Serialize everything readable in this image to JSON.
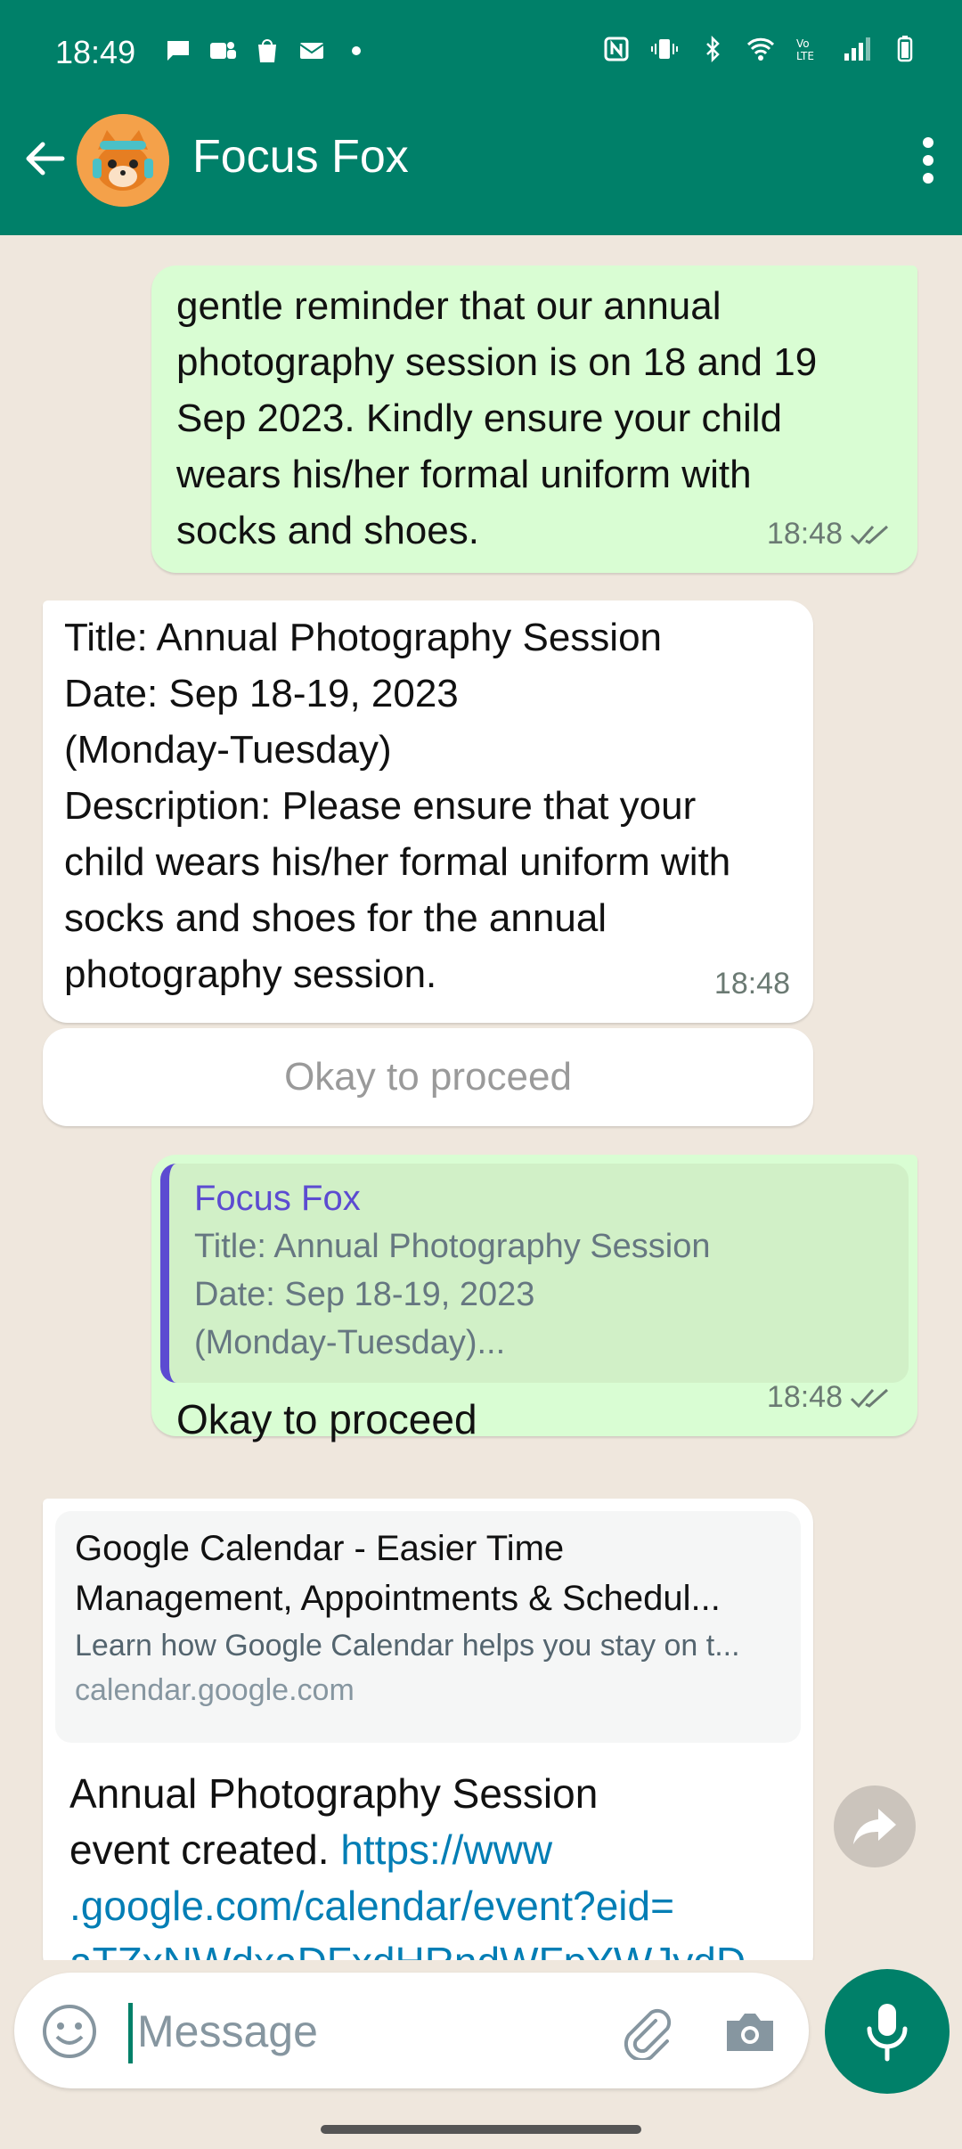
{
  "status_bar": {
    "time": "18:49"
  },
  "header": {
    "title": "Focus Fox"
  },
  "messages": {
    "m1": {
      "text": "gentle reminder that our annual photography session is on 18 and 19 Sep 2023. Kindly ensure your child wears his/her formal uniform with socks and shoes.",
      "time": "18:48"
    },
    "m2": {
      "lines": [
        "Title: Annual Photography Session",
        "Date: Sep 18-19, 2023",
        "(Monday-Tuesday)",
        "Description: Please ensure that your child wears his/her formal uniform with socks and shoes for the annual photography session."
      ],
      "time": "18:48",
      "button": "Okay to proceed"
    },
    "m3": {
      "quote_author": "Focus Fox",
      "quote_lines": [
        "Title: Annual Photography Session",
        "Date: Sep 18-19, 2023",
        "(Monday-Tuesday)..."
      ],
      "text": "Okay to proceed",
      "time": "18:48"
    },
    "m4": {
      "preview_title_1": "Google Calendar - Easier Time",
      "preview_title_2": "Management, Appointments & Schedul...",
      "preview_desc": "Learn how Google Calendar helps you stay on t...",
      "preview_domain": "calendar.google.com",
      "text_1": "Annual Photography Session",
      "text_2": "event created.",
      "link_1": "https://www",
      "link_2": ".google.com/calendar/event?eid=",
      "link_3": "aTZxNWdxaDFxdHRndWFpYWJydD"
    }
  },
  "composer": {
    "placeholder": "Message"
  },
  "colors": {
    "header": "#008069",
    "outgoing": "#d9fdd3",
    "incoming": "#ffffff",
    "link": "#027eb5"
  }
}
